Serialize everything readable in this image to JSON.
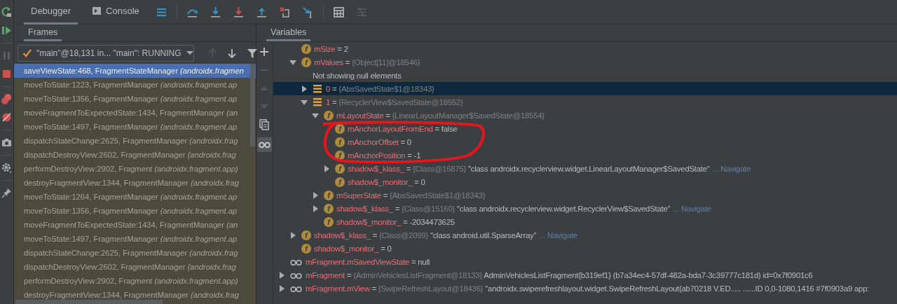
{
  "tabs": [
    {
      "label": "Debugger",
      "selected": true
    },
    {
      "label": "Console",
      "selected": false
    }
  ],
  "frames_panel": {
    "title": "Frames",
    "thread_selector": {
      "value": "\"main\"@18,131 in... \"main\": RUNNING"
    },
    "frames": [
      {
        "text": "saveViewState:468, FragmentStateManager *(androidx.fragmen*",
        "selected": true
      },
      {
        "text": "moveToState:1223, FragmentManager *(androidx.fragment.ap*",
        "selected": false
      },
      {
        "text": "moveToState:1356, FragmentManager *(androidx.fragment.ap*",
        "selected": false
      },
      {
        "text": "moveFragmentToExpectedState:1434, FragmentManager *(an*",
        "selected": false
      },
      {
        "text": "moveToState:1497, FragmentManager *(androidx.fragment.ap*",
        "selected": false
      },
      {
        "text": "dispatchStateChange:2625, FragmentManager *(androidx.frag*",
        "selected": false
      },
      {
        "text": "dispatchDestroyView:2602, FragmentManager *(androidx.frag*",
        "selected": false
      },
      {
        "text": "performDestroyView:2902, Fragment *(androidx.fragment.app)*",
        "selected": false
      },
      {
        "text": "destroyFragmentView:1344, FragmentManager *(androidx.frag*",
        "selected": false
      },
      {
        "text": "moveToState:1264, FragmentManager *(androidx.fragment.ap*",
        "selected": false
      },
      {
        "text": "moveToState:1356, FragmentManager *(androidx.fragment.ap*",
        "selected": false
      },
      {
        "text": "moveFragmentToExpectedState:1434, FragmentManager *(an*",
        "selected": false
      },
      {
        "text": "moveToState:1497, FragmentManager *(androidx.fragment.ap*",
        "selected": false
      },
      {
        "text": "dispatchStateChange:2625, FragmentManager *(androidx.frag*",
        "selected": false
      },
      {
        "text": "dispatchDestroyView:2602, FragmentManager *(androidx.frag*",
        "selected": false
      },
      {
        "text": "performDestroyView:2902, Fragment *(androidx.fragment.app)*",
        "selected": false
      },
      {
        "text": "destroyFragmentView:1344, FragmentManager *(androidx.frag*",
        "selected": false
      }
    ]
  },
  "variables_panel": {
    "title": "Variables",
    "fields": [
      {
        "kind": "field",
        "icon_letter": "f",
        "name": "mSize",
        "operator": "=",
        "value": "2",
        "selected": false
      },
      {
        "kind": "field",
        "icon_letter": "f",
        "name": "mValues",
        "operator": "=",
        "type": "{Object[11]@18546}",
        "expanded": true,
        "selected": false,
        "children": [
          {
            "kind": "note",
            "text": "Not showing null elements"
          },
          {
            "kind": "element",
            "name": "0",
            "operator": "=",
            "type": "{AbsSavedState$1@18343}",
            "expanded": false,
            "selected": true
          },
          {
            "kind": "element",
            "name": "1",
            "operator": "=",
            "type": "{RecyclerView$SavedState@18552}",
            "expanded": true,
            "selected": false,
            "children": [
              {
                "kind": "field",
                "icon_letter": "f",
                "name": "mLayoutState",
                "operator": "=",
                "type": "{LinearLayoutManager$SavedState@18554}",
                "expanded": true,
                "selected": false,
                "children": [
                  {
                    "kind": "field",
                    "icon_letter": "f",
                    "name": "mAnchorLayoutFromEnd",
                    "operator": "=",
                    "value": "false",
                    "selected": false
                  },
                  {
                    "kind": "field",
                    "icon_letter": "f",
                    "name": "mAnchorOffset",
                    "operator": "=",
                    "value": "0",
                    "selected": false
                  },
                  {
                    "kind": "field",
                    "icon_letter": "f",
                    "name": "mAnchorPosition",
                    "operator": "=",
                    "value": "-1",
                    "selected": false
                  },
                  {
                    "kind": "field",
                    "icon_letter": "f",
                    "name": "shadow$_klass_",
                    "operator": "=",
                    "type": "{Class@16875}",
                    "value": "\"class androidx.recyclerview.widget.LinearLayoutManager$SavedState\"",
                    "navigate": "... Navigate",
                    "expanded": false,
                    "selected": false
                  },
                  {
                    "kind": "field",
                    "icon_letter": "f",
                    "name": "shadow$_monitor_",
                    "operator": "=",
                    "value": "0",
                    "selected": false
                  }
                ]
              },
              {
                "kind": "field",
                "icon_letter": "f",
                "name": "mSuperState",
                "operator": "=",
                "type": "{AbsSavedState$1@18343}",
                "expanded": false,
                "selected": false
              },
              {
                "kind": "field",
                "icon_letter": "f",
                "name": "shadow$_klass_",
                "operator": "=",
                "type": "{Class@15160}",
                "value": "\"class androidx.recyclerview.widget.RecyclerView$SavedState\"",
                "navigate": "... Navigate",
                "expanded": false,
                "selected": false
              },
              {
                "kind": "field",
                "icon_letter": "f",
                "name": "shadow$_monitor_",
                "operator": "=",
                "value": "-2034473625",
                "selected": false
              }
            ]
          }
        ]
      },
      {
        "kind": "field",
        "icon_letter": "f",
        "name": "shadow$_klass_",
        "operator": "=",
        "type": "{Class@2099}",
        "value": "\"class android.util.SparseArray\"",
        "navigate": "... Navigate",
        "expanded": false,
        "selected": false
      },
      {
        "kind": "field",
        "icon_letter": "f",
        "name": "shadow$_monitor_",
        "operator": "=",
        "value": "0",
        "selected": false
      }
    ],
    "watches": [
      {
        "kind": "watch",
        "name": "mFragment.mSavedViewState",
        "operator": "=",
        "value": "null",
        "selected": false
      },
      {
        "kind": "watch",
        "name": "mFragment",
        "operator": "=",
        "type": "{AdminVehiclesListFragment@18133}",
        "value": "AdminVehiclesListFragment{b319ef1} (b7a34ec4-57df-482a-bda7-3c39777c181d) id=0x7f0901c6",
        "expanded": false,
        "selected": false
      },
      {
        "kind": "watch",
        "name": "mFragment.mView",
        "operator": "=",
        "type": "{SwipeRefreshLayout@18436}",
        "value": "\"androidx.swiperefreshlayout.widget.SwipeRefreshLayout{ab70218 V.ED..... ......ID 0,0-1080,1416 #7f0903a9 app:",
        "expanded": false,
        "selected": false
      }
    ]
  },
  "annotation": {
    "kind": "freehand-circle"
  }
}
